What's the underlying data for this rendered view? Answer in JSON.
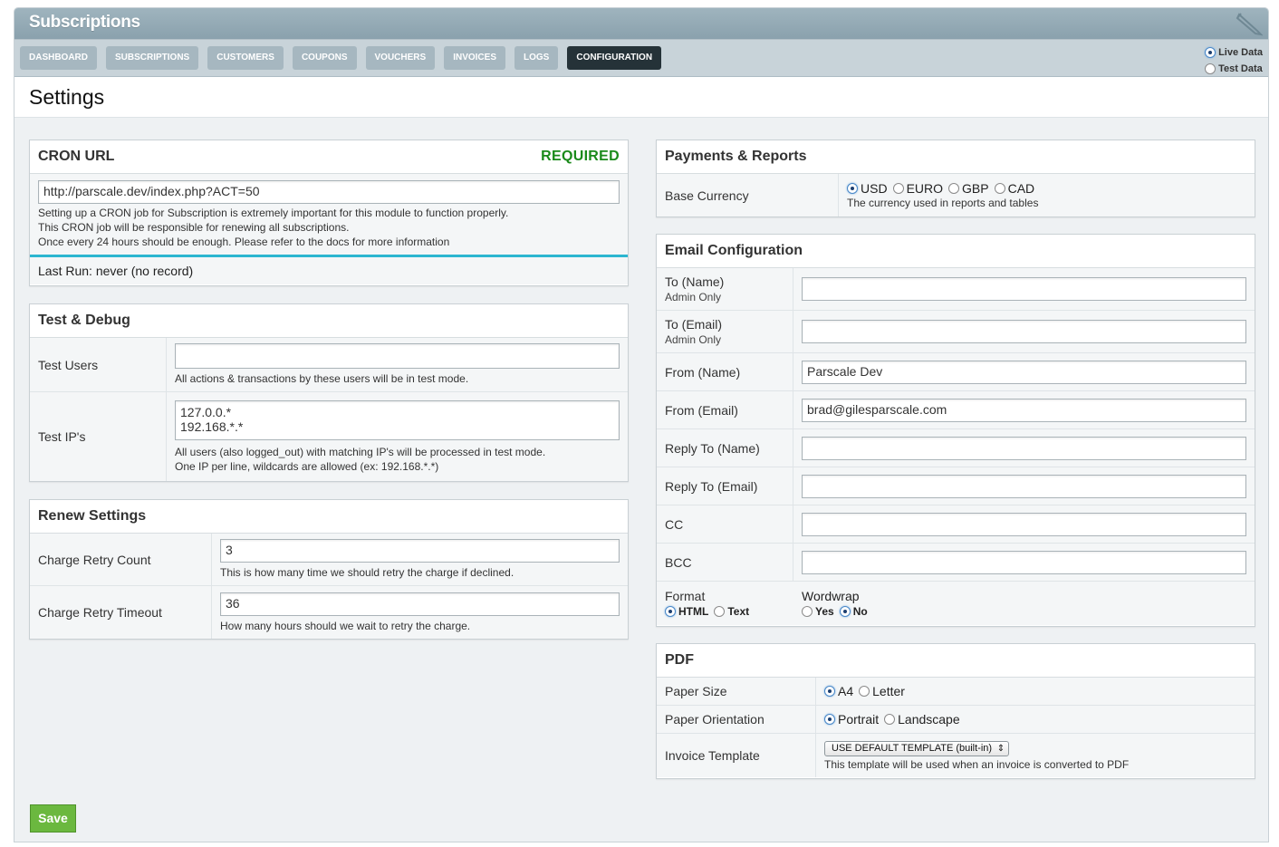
{
  "app": {
    "title": "Subscriptions"
  },
  "nav": {
    "tabs": [
      "DASHBOARD",
      "SUBSCRIPTIONS",
      "CUSTOMERS",
      "COUPONS",
      "VOUCHERS",
      "INVOICES",
      "LOGS",
      "CONFIGURATION"
    ],
    "active": "CONFIGURATION"
  },
  "datamode": {
    "live": "Live Data",
    "test": "Test Data",
    "selected": "Live Data"
  },
  "page": {
    "title": "Settings"
  },
  "cron": {
    "title": "CRON URL",
    "required": "REQUIRED",
    "url": "http://parscale.dev/index.php?ACT=50",
    "help1": "Setting up a CRON job for Subscription is extremely important for this module to function properly.",
    "help2": "This CRON job will be responsible for renewing all subscriptions.",
    "help3": "Once every 24 hours should be enough. Please refer to the docs for more information",
    "last_run": "Last Run: never (no record)"
  },
  "debug": {
    "title": "Test & Debug",
    "users_label": "Test Users",
    "users_value": "",
    "users_help": "All actions & transactions by these users will be in test mode.",
    "ips_label": "Test IP's",
    "ips_value": "127.0.0.*\n192.168.*.*",
    "ips_help1": "All users (also logged_out) with matching IP's will be processed in test mode.",
    "ips_help2": "One IP per line, wildcards are allowed (ex: 192.168.*.*)"
  },
  "renew": {
    "title": "Renew Settings",
    "count_label": "Charge Retry Count",
    "count_value": "3",
    "count_help": "This is how many time we should retry the charge if declined.",
    "timeout_label": "Charge Retry Timeout",
    "timeout_value": "36",
    "timeout_help": "How many hours should we wait to retry the charge."
  },
  "payments": {
    "title": "Payments & Reports",
    "currency_label": "Base Currency",
    "currencies": [
      "USD",
      "EURO",
      "GBP",
      "CAD"
    ],
    "selected": "USD",
    "help": "The currency used in reports and tables"
  },
  "email": {
    "title": "Email Configuration",
    "to_name": {
      "label": "To (Name)",
      "sub": "Admin Only",
      "value": ""
    },
    "to_email": {
      "label": "To (Email)",
      "sub": "Admin Only",
      "value": ""
    },
    "from_name": {
      "label": "From (Name)",
      "value": "Parscale Dev"
    },
    "from_email": {
      "label": "From (Email)",
      "value": "brad@gilesparscale.com"
    },
    "reply_name": {
      "label": "Reply To (Name)",
      "value": ""
    },
    "reply_email": {
      "label": "Reply To (Email)",
      "value": ""
    },
    "cc": {
      "label": "CC",
      "value": ""
    },
    "bcc": {
      "label": "BCC",
      "value": ""
    },
    "format": {
      "label": "Format",
      "options": [
        "HTML",
        "Text"
      ],
      "selected": "HTML"
    },
    "wordwrap": {
      "label": "Wordwrap",
      "options": [
        "Yes",
        "No"
      ],
      "selected": "No"
    }
  },
  "pdf": {
    "title": "PDF",
    "paper_size_label": "Paper Size",
    "paper_sizes": [
      "A4",
      "Letter"
    ],
    "paper_size": "A4",
    "orientation_label": "Paper Orientation",
    "orientations": [
      "Portrait",
      "Landscape"
    ],
    "orientation": "Portrait",
    "template_label": "Invoice Template",
    "template_value": "USE DEFAULT TEMPLATE (built-in)",
    "template_help": "This template will be used when an invoice is converted to PDF"
  },
  "actions": {
    "save": "Save"
  }
}
